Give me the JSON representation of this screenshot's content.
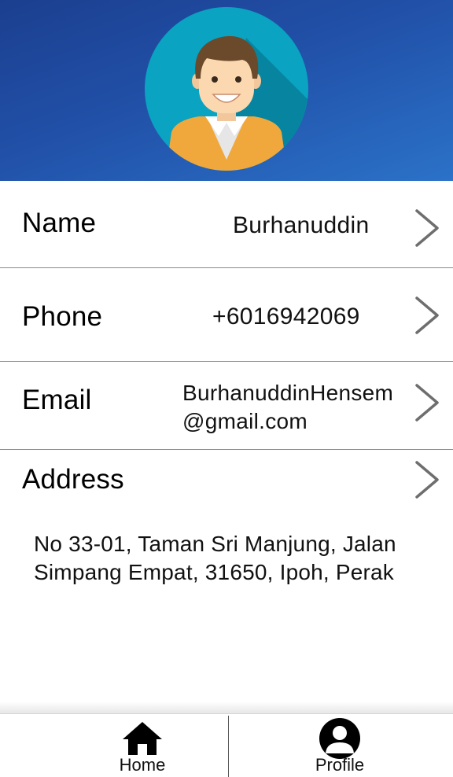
{
  "header": {
    "avatar_icon": "user-avatar-icon"
  },
  "profile": {
    "name": {
      "label": "Name",
      "value": "Burhanuddin"
    },
    "phone": {
      "label": "Phone",
      "value": "+6016942069"
    },
    "email": {
      "label": "Email",
      "value_line1": "BurhanuddinHensem",
      "value_line2": "@gmail.com"
    },
    "address": {
      "label": "Address",
      "value_line1": "No 33-01, Taman Sri Manjung, Jalan",
      "value_line2": "Simpang Empat, 31650, Ipoh, Perak"
    }
  },
  "bottom_nav": {
    "home": {
      "label": "Home",
      "icon": "home-icon"
    },
    "profile": {
      "label": "Profile",
      "icon": "profile-icon"
    }
  },
  "colors": {
    "header_start": "#1b3f8f",
    "header_end": "#2b72c8",
    "avatar_circle": "#0aa3c2",
    "shirt": "#f0a83c",
    "chevron": "#6e6e6e"
  }
}
